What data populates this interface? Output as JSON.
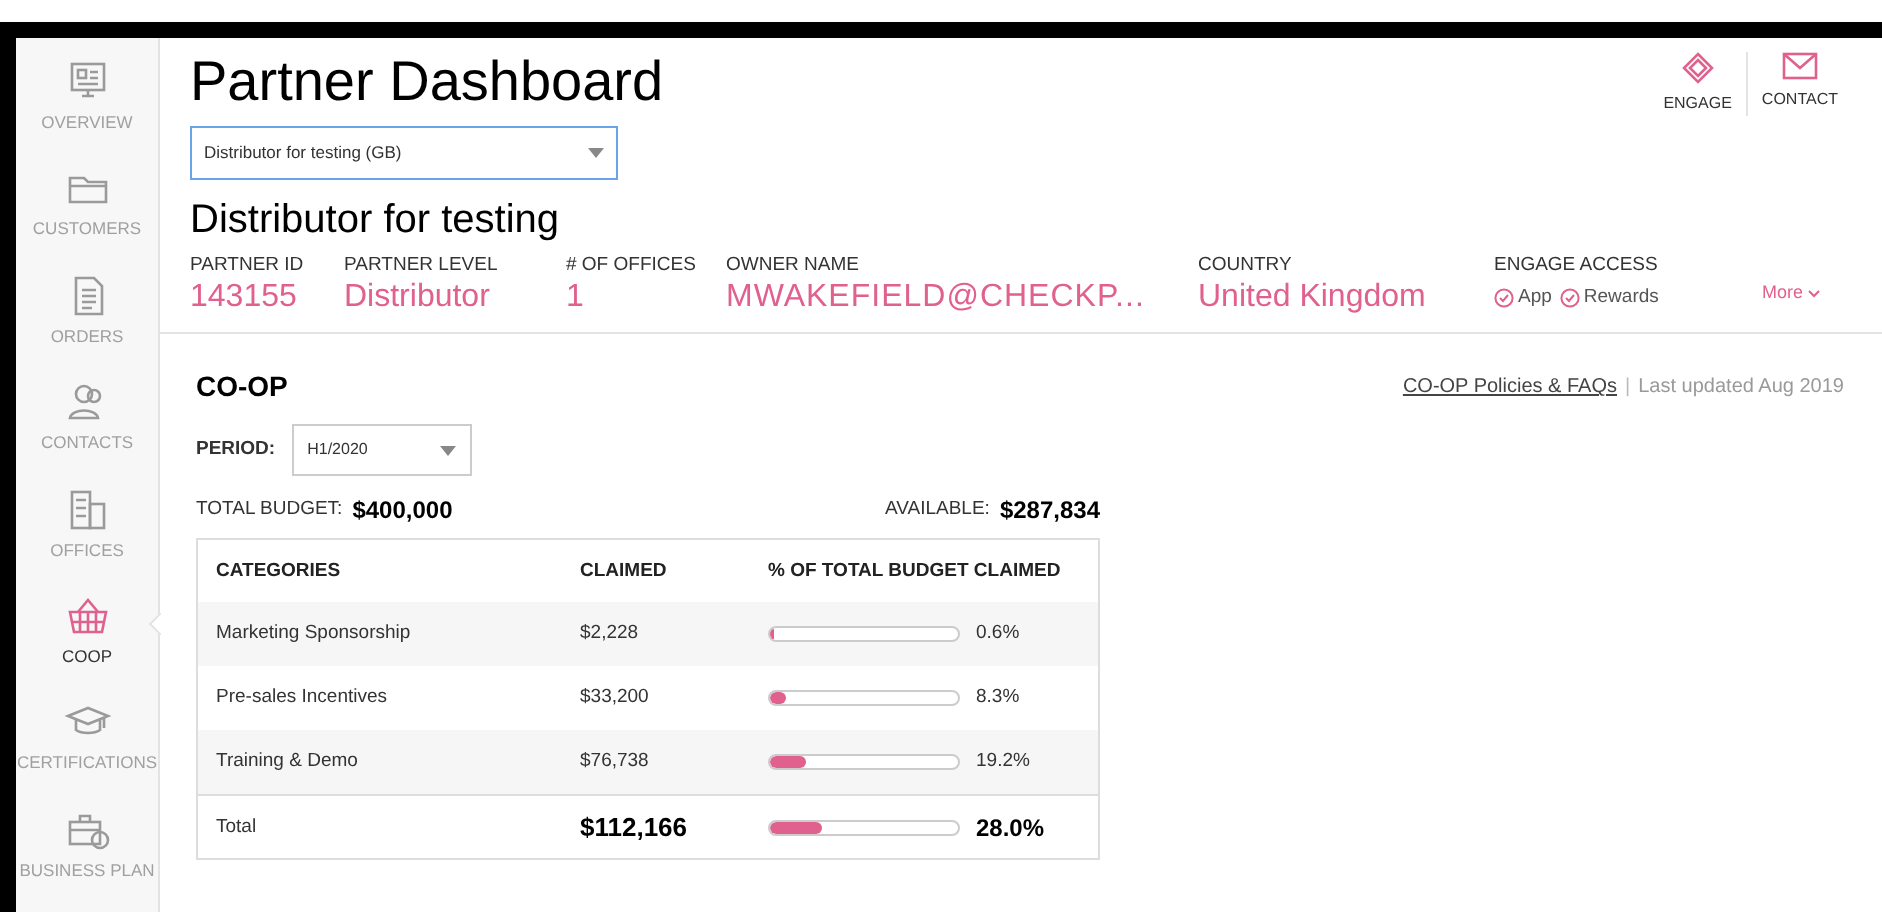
{
  "sidebar": {
    "items": [
      {
        "label": "OVERVIEW",
        "selected": false
      },
      {
        "label": "CUSTOMERS",
        "selected": false
      },
      {
        "label": "ORDERS",
        "selected": false
      },
      {
        "label": "CONTACTS",
        "selected": false
      },
      {
        "label": "OFFICES",
        "selected": false
      },
      {
        "label": "COOP",
        "selected": true
      },
      {
        "label": "CERTIFICATIONS",
        "selected": false
      },
      {
        "label": "BUSINESS PLAN",
        "selected": false
      }
    ]
  },
  "header": {
    "title": "Partner Dashboard",
    "actions": [
      {
        "label": "ENGAGE"
      },
      {
        "label": "CONTACT"
      }
    ]
  },
  "partner_select": {
    "value": "Distributor for testing (GB)"
  },
  "partner": {
    "name": "Distributor for testing",
    "fields": [
      {
        "label": "PARTNER ID",
        "value": "143155"
      },
      {
        "label": "PARTNER LEVEL",
        "value": "Distributor"
      },
      {
        "label": "# OF OFFICES",
        "value": "1"
      },
      {
        "label": "OWNER NAME",
        "value": "MWAKEFIELD@CHECKP..."
      },
      {
        "label": "COUNTRY",
        "value": "United Kingdom"
      }
    ],
    "engage_access": {
      "label": "ENGAGE ACCESS",
      "items": [
        "App",
        "Rewards"
      ]
    },
    "more": "More"
  },
  "coop": {
    "title": "CO-OP",
    "policies_link": "CO-OP Policies & FAQs",
    "separator": "|",
    "last_updated": "Last updated Aug 2019",
    "period": {
      "label": "PERIOD:",
      "value": "H1/2020"
    },
    "total_budget": {
      "label": "TOTAL BUDGET:",
      "value": "$400,000"
    },
    "available": {
      "label": "AVAILABLE:",
      "value": "$287,834"
    },
    "table": {
      "columns": [
        "CATEGORIES",
        "CLAIMED",
        "% OF TOTAL BUDGET CLAIMED"
      ],
      "rows": [
        {
          "category": "Marketing Sponsorship",
          "claimed": "$2,228",
          "level": 0.006,
          "percent": "0.6%",
          "kind": "item"
        },
        {
          "category": "Pre-sales Incentives",
          "claimed": "$33,200",
          "level": 0.083,
          "percent": "8.3%",
          "kind": "item"
        },
        {
          "category": "Training & Demo",
          "claimed": "$76,738",
          "level": 0.192,
          "percent": "19.2%",
          "kind": "item"
        },
        {
          "category": "Total",
          "claimed": "$112,166",
          "level": 0.28,
          "percent": "28.0%",
          "kind": "total"
        }
      ]
    }
  }
}
